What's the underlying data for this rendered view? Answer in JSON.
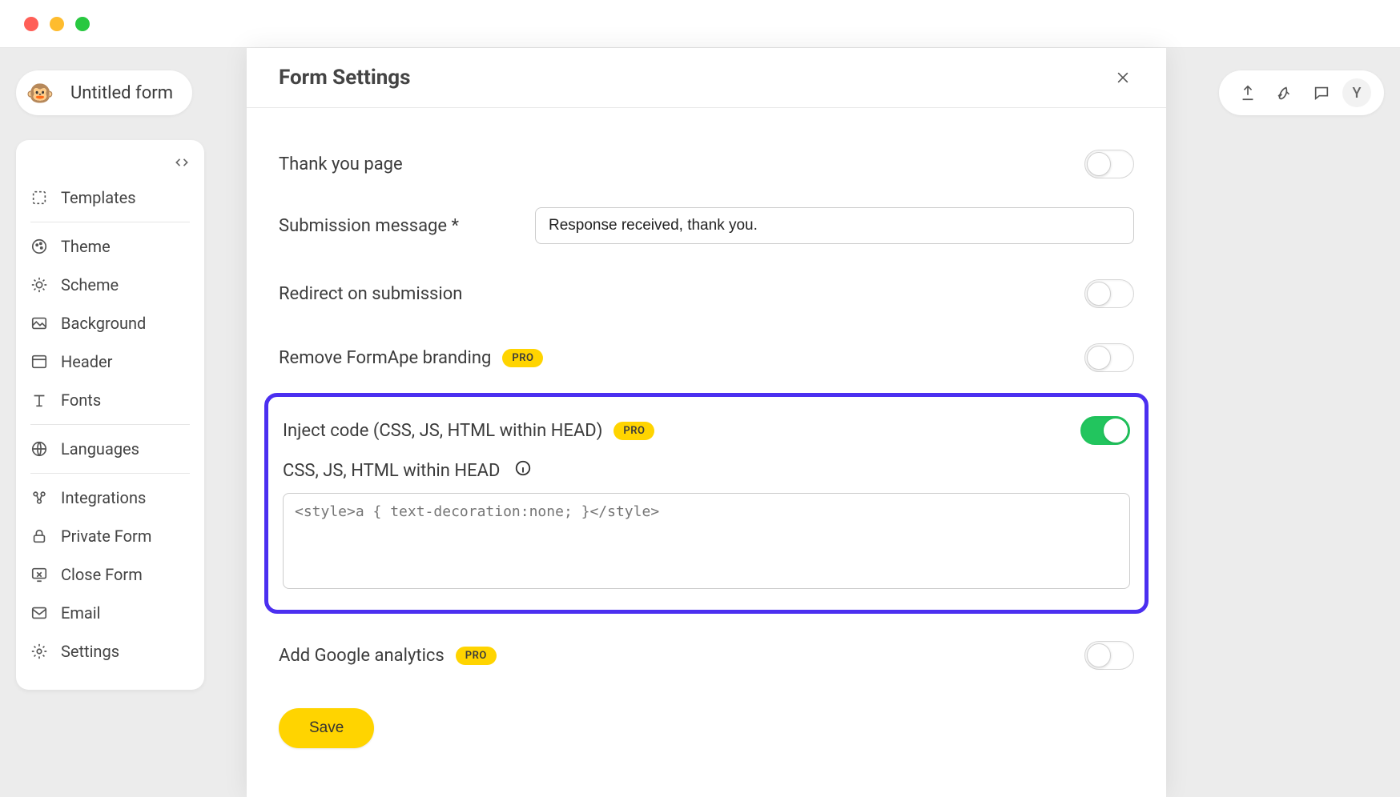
{
  "window": {
    "form_title": "Untitled form",
    "avatar_letter": "Y"
  },
  "sidebar": {
    "items": [
      {
        "label": "Templates"
      },
      {
        "label": "Theme"
      },
      {
        "label": "Scheme"
      },
      {
        "label": "Background"
      },
      {
        "label": "Header"
      },
      {
        "label": "Fonts"
      },
      {
        "label": "Languages"
      },
      {
        "label": "Integrations"
      },
      {
        "label": "Private Form"
      },
      {
        "label": "Close Form"
      },
      {
        "label": "Email"
      },
      {
        "label": "Settings"
      }
    ]
  },
  "modal": {
    "title": "Form Settings",
    "thank_you_label": "Thank you page",
    "submission_label": "Submission message *",
    "submission_value": "Response received, thank you.",
    "redirect_label": "Redirect on submission",
    "remove_branding_label": "Remove FormApe branding",
    "inject_label": "Inject code (CSS, JS, HTML within HEAD)",
    "code_field_label": "CSS, JS, HTML within HEAD",
    "code_placeholder": "<style>a { text-decoration:none; }</style>",
    "analytics_label": "Add Google analytics",
    "pro_badge": "PRO",
    "save_label": "Save",
    "toggles": {
      "thank_you": false,
      "redirect": false,
      "remove_branding": false,
      "inject_code": true,
      "analytics": false
    }
  }
}
